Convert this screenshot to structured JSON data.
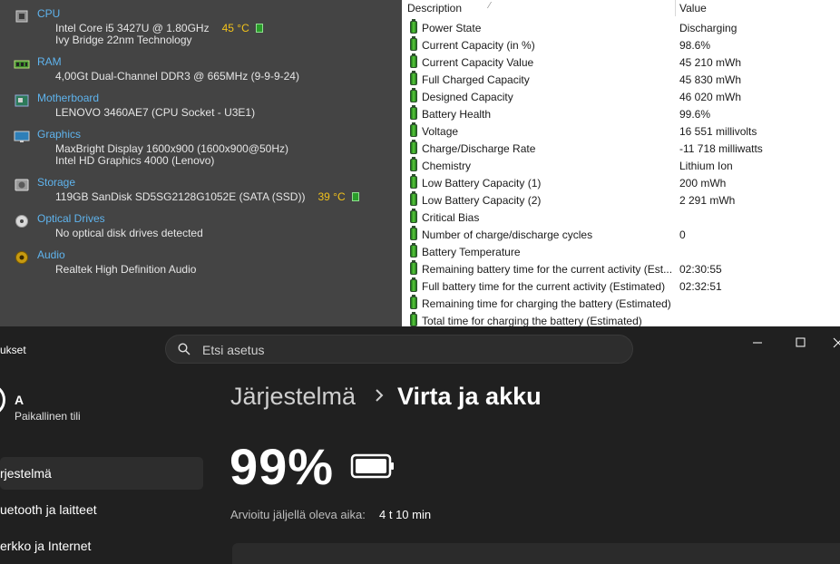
{
  "summary": {
    "sections": [
      {
        "title": "CPU",
        "icon": "cpu-icon",
        "lines": [
          "Intel Core i5 3427U @ 1.80GHz",
          "Ivy Bridge 22nm Technology"
        ],
        "temp": "45 °C"
      },
      {
        "title": "RAM",
        "icon": "ram-icon",
        "lines": [
          "4,00Gt Dual-Channel DDR3 @ 665MHz (9-9-9-24)"
        ]
      },
      {
        "title": "Motherboard",
        "icon": "motherboard-icon",
        "lines": [
          "LENOVO 3460AE7 (CPU Socket - U3E1)"
        ]
      },
      {
        "title": "Graphics",
        "icon": "monitor-icon",
        "lines": [
          "MaxBright Display 1600x900 (1600x900@50Hz)",
          "Intel HD Graphics 4000 (Lenovo)"
        ]
      },
      {
        "title": "Storage",
        "icon": "hard-drive-icon",
        "lines": [
          "119GB SanDisk SD5SG2128G1052E (SATA (SSD))"
        ],
        "temp": "39 °C"
      },
      {
        "title": "Optical Drives",
        "icon": "optical-disc-icon",
        "lines": [
          "No optical disk drives detected"
        ]
      },
      {
        "title": "Audio",
        "icon": "speaker-icon",
        "lines": [
          "Realtek High Definition Audio"
        ]
      }
    ],
    "colors": {
      "section_title": "#5fb4ee",
      "temperature": "#f2c21b",
      "panel_bg": "#444444"
    }
  },
  "battery": {
    "columns": {
      "description": "Description",
      "value": "Value"
    },
    "rows": [
      {
        "desc": "Power State",
        "value": "Discharging"
      },
      {
        "desc": "Current Capacity (in %)",
        "value": "98.6%"
      },
      {
        "desc": "Current Capacity Value",
        "value": "45 210 mWh"
      },
      {
        "desc": "Full Charged Capacity",
        "value": "45 830 mWh"
      },
      {
        "desc": "Designed Capacity",
        "value": "46 020 mWh"
      },
      {
        "desc": "Battery Health",
        "value": "99.6%"
      },
      {
        "desc": "Voltage",
        "value": "16 551 millivolts"
      },
      {
        "desc": "Charge/Discharge Rate",
        "value": "-11 718 milliwatts"
      },
      {
        "desc": "Chemistry",
        "value": "Lithium Ion"
      },
      {
        "desc": "Low Battery Capacity (1)",
        "value": "200 mWh"
      },
      {
        "desc": "Low Battery Capacity (2)",
        "value": "2 291 mWh"
      },
      {
        "desc": "Critical Bias",
        "value": ""
      },
      {
        "desc": "Number of charge/discharge cycles",
        "value": "0"
      },
      {
        "desc": "Battery Temperature",
        "value": ""
      },
      {
        "desc": "Remaining battery time for the current activity (Est...",
        "value": "02:30:55"
      },
      {
        "desc": "Full battery time for the current activity (Estimated)",
        "value": "02:32:51"
      },
      {
        "desc": "Remaining time for charging the battery (Estimated)",
        "value": ""
      },
      {
        "desc": "Total  time for charging the battery (Estimated)",
        "value": ""
      }
    ],
    "icon": "battery-icon"
  },
  "settings": {
    "app_title": "ukset",
    "search": {
      "placeholder": "Etsi asetus",
      "icon": "search-icon"
    },
    "user": {
      "name": "A",
      "account": "Paikallinen tili"
    },
    "nav": [
      {
        "label": "rjestelmä",
        "active": true
      },
      {
        "label": "uetooth ja laitteet",
        "active": false
      },
      {
        "label": "erkko ja Internet",
        "active": false
      }
    ],
    "breadcrumb": {
      "parent": "Järjestelmä",
      "current": "Virta ja akku"
    },
    "battery_percent": "99%",
    "remaining": {
      "label": "Arvioitu jäljellä oleva aika:",
      "value": "4 t 10 min"
    },
    "colors": {
      "window_bg": "#202020",
      "card_bg": "#2b2b2b",
      "nav_active_bg": "#2d2d2d"
    }
  }
}
